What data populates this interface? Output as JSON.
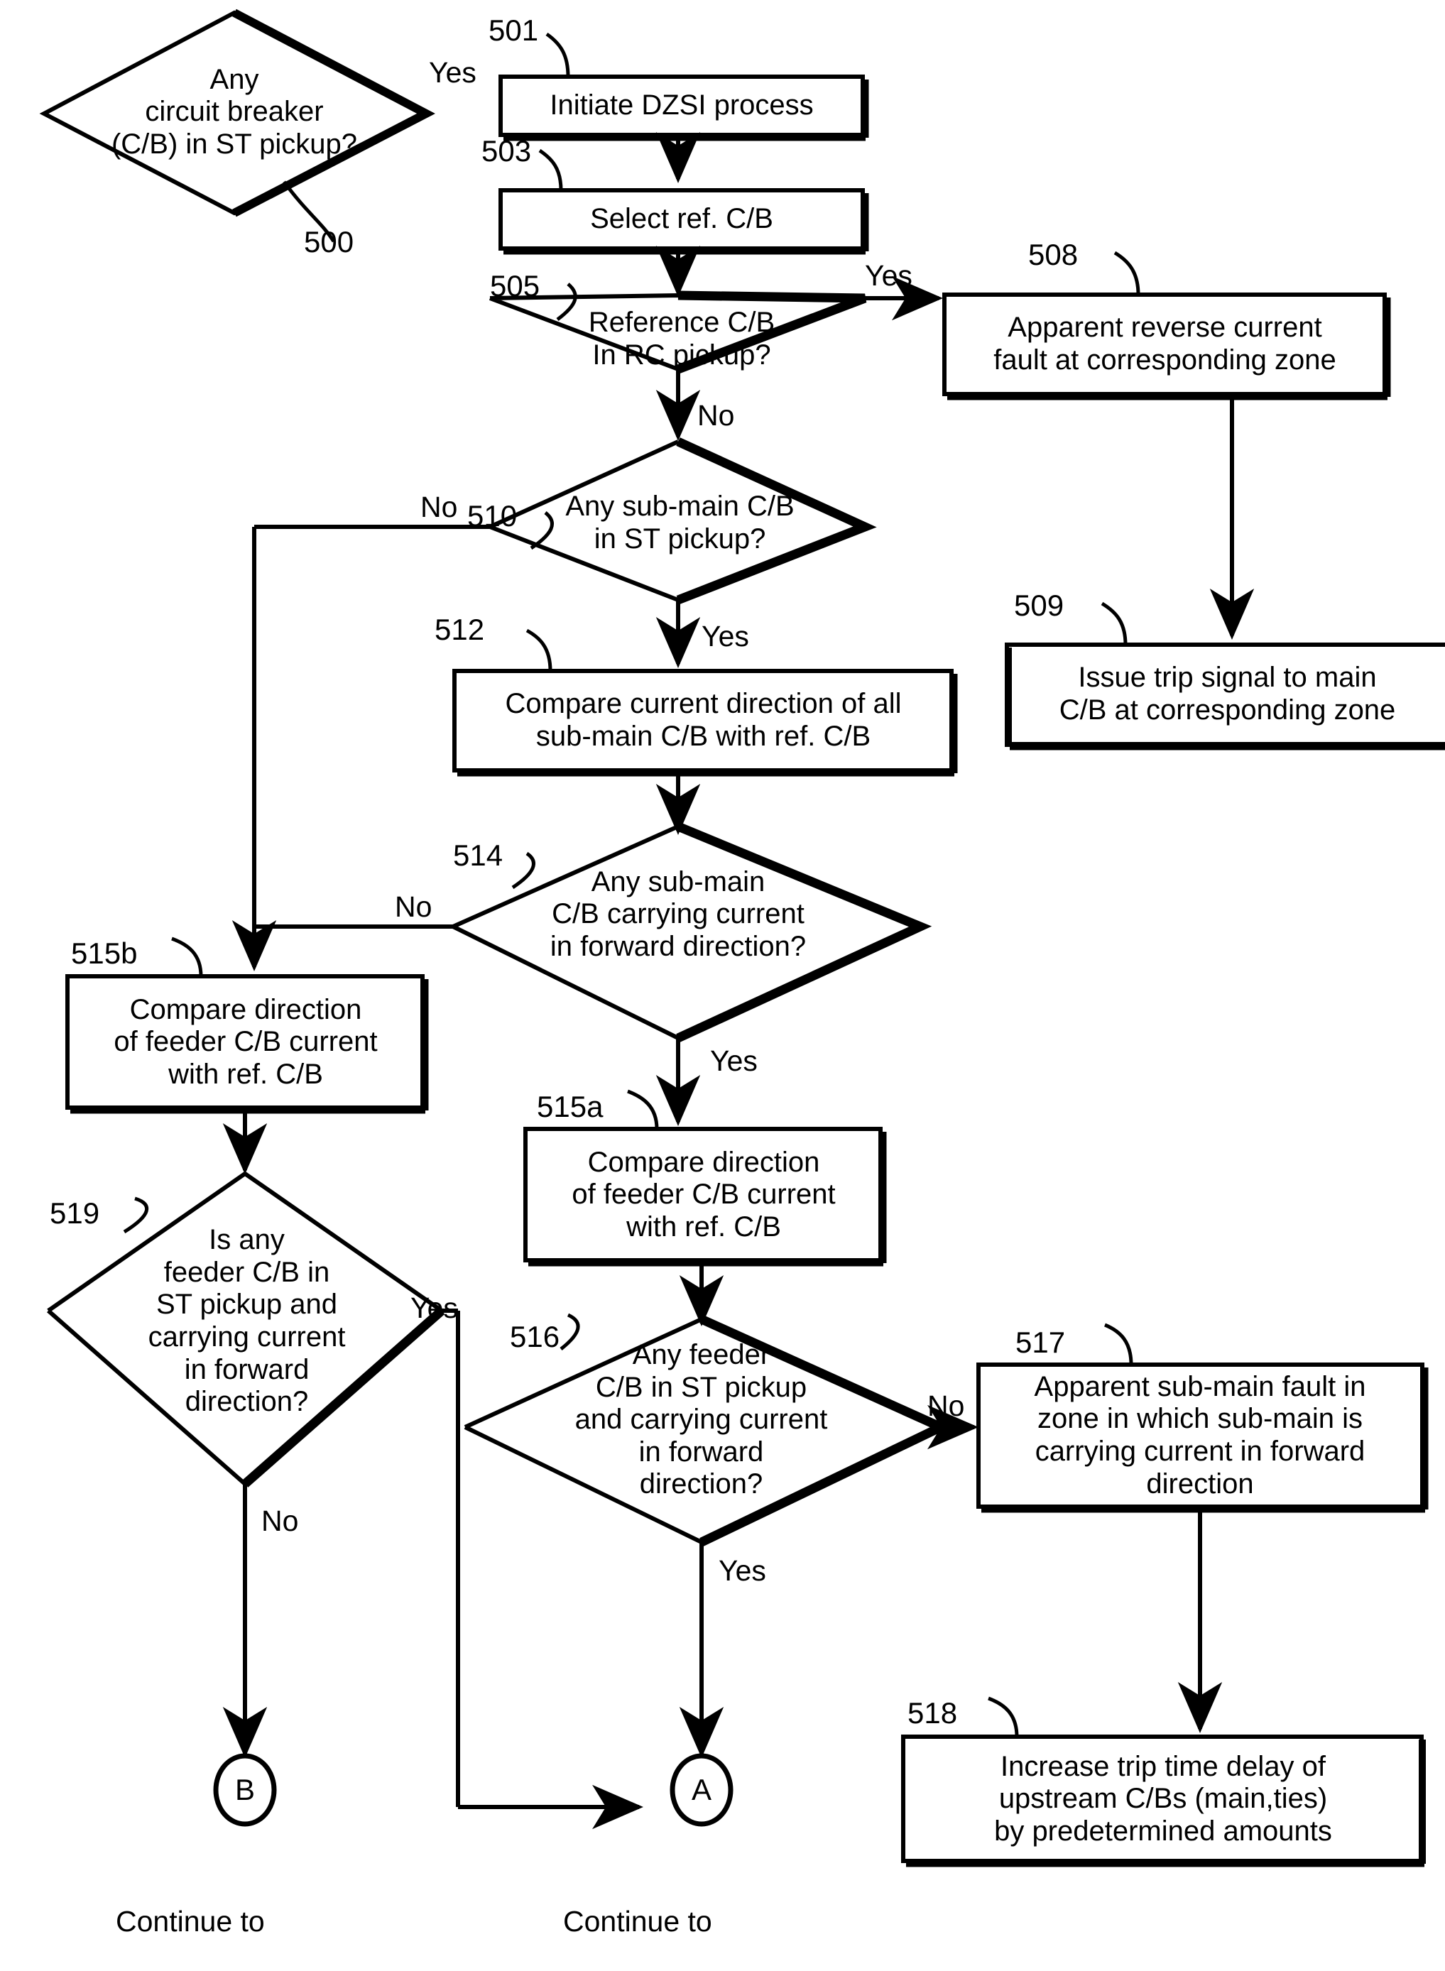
{
  "figure": {
    "type": "patent-flowchart",
    "nodes": [
      {
        "id": "500",
        "ref": "500",
        "shape": "decision",
        "text": "Any\ncircuit breaker\n(C/B) in ST pickup?"
      },
      {
        "id": "501",
        "ref": "501",
        "shape": "process",
        "text": "Initiate DZSI process"
      },
      {
        "id": "503",
        "ref": "503",
        "shape": "process",
        "text": "Select ref. C/B"
      },
      {
        "id": "505",
        "ref": "505",
        "shape": "decision",
        "text": "Reference C/B\nIn RC pickup?"
      },
      {
        "id": "508",
        "ref": "508",
        "shape": "process",
        "text": "Apparent reverse current\nfault at corresponding zone"
      },
      {
        "id": "509",
        "ref": "509",
        "shape": "process",
        "text": "Issue trip signal to main\nC/B at corresponding zone"
      },
      {
        "id": "510",
        "ref": "510",
        "shape": "decision",
        "text": "Any sub-main C/B\nin ST pickup?"
      },
      {
        "id": "512",
        "ref": "512",
        "shape": "process",
        "text": "Compare current direction of all\nsub-main C/B with ref. C/B"
      },
      {
        "id": "514",
        "ref": "514",
        "shape": "decision",
        "text": "Any sub-main\nC/B carrying current\nin forward direction?"
      },
      {
        "id": "515b",
        "ref": "515b",
        "shape": "process",
        "text": "Compare direction\nof feeder C/B current\nwith ref. C/B"
      },
      {
        "id": "515a",
        "ref": "515a",
        "shape": "process",
        "text": "Compare direction\nof feeder C/B current\nwith ref. C/B"
      },
      {
        "id": "519",
        "ref": "519",
        "shape": "decision",
        "text": "Is any\nfeeder C/B in\nST pickup and\ncarrying current\nin forward\ndirection?"
      },
      {
        "id": "516",
        "ref": "516",
        "shape": "decision",
        "text": "Any feeder\nC/B in ST pickup\nand carrying current\nin forward\ndirection?"
      },
      {
        "id": "517",
        "ref": "517",
        "shape": "process",
        "text": "Apparent sub-main fault in\nzone in which sub-main is\ncarrying current in forward\ndirection"
      },
      {
        "id": "518",
        "ref": "518",
        "shape": "process",
        "text": "Increase trip time delay of\nupstream C/Bs (main,ties)\nby predetermined amounts"
      },
      {
        "id": "connA",
        "shape": "connector",
        "text": "A",
        "caption": "Continue to"
      },
      {
        "id": "connB",
        "shape": "connector",
        "text": "B",
        "caption": "Continue to"
      }
    ],
    "edge_labels": {
      "e500_yes": "Yes",
      "e505_yes": "Yes",
      "e505_no": "No",
      "e510_no": "No",
      "e510_yes": "Yes",
      "e514_no": "No",
      "e514_yes": "Yes",
      "e519_yes": "Yes",
      "e519_no": "No",
      "e516_no": "No",
      "e516_yes": "Yes"
    },
    "captions": {
      "continue_b": "Continue to",
      "continue_a": "Continue to"
    },
    "colors": {
      "stroke": "#000000",
      "fill": "#ffffff",
      "text": "#000000"
    }
  }
}
